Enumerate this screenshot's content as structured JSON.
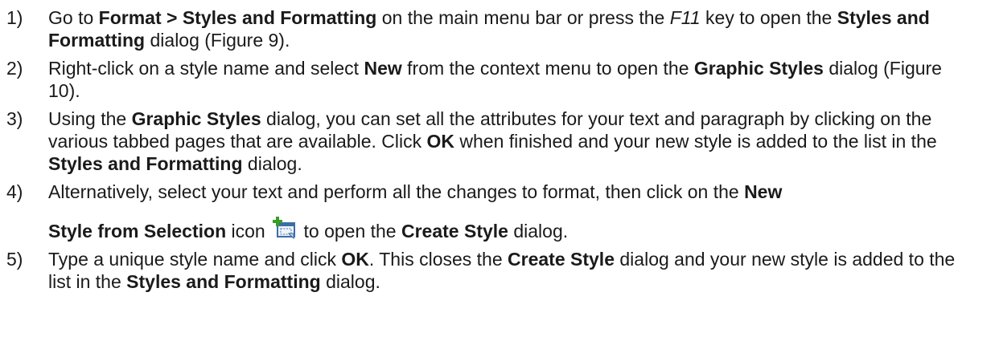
{
  "steps": [
    {
      "num": "1)",
      "segments": [
        {
          "t": "Go to ",
          "s": "n"
        },
        {
          "t": "Format > Styles and Formatting",
          "s": "b"
        },
        {
          "t": " on the main menu bar or press the ",
          "s": "n"
        },
        {
          "t": "F11",
          "s": "i"
        },
        {
          "t": " key to open the ",
          "s": "n"
        },
        {
          "t": "Styles and Formatting",
          "s": "b"
        },
        {
          "t": " dialog (Figure 9).",
          "s": "n"
        }
      ]
    },
    {
      "num": "2)",
      "segments": [
        {
          "t": "Right-click on a style name and select ",
          "s": "n"
        },
        {
          "t": "New",
          "s": "b"
        },
        {
          "t": " from the context menu to open the ",
          "s": "n"
        },
        {
          "t": "Graphic Styles",
          "s": "b"
        },
        {
          "t": " dialog (Figure 10).",
          "s": "n"
        }
      ]
    },
    {
      "num": "3)",
      "segments": [
        {
          "t": "Using the ",
          "s": "n"
        },
        {
          "t": "Graphic Styles",
          "s": "b"
        },
        {
          "t": " dialog, you can set all the attributes for your text and paragraph by clicking on the various tabbed pages that are available. Click ",
          "s": "n"
        },
        {
          "t": "OK",
          "s": "b"
        },
        {
          "t": " when finished and your new style is added to the list in the ",
          "s": "n"
        },
        {
          "t": "Styles and Formatting",
          "s": "b"
        },
        {
          "t": " dialog.",
          "s": "n"
        }
      ]
    },
    {
      "num": "4)",
      "line1": [
        {
          "t": "Alternatively, select your text and perform all the changes to format, then click on the ",
          "s": "n"
        },
        {
          "t": "New",
          "s": "b"
        }
      ],
      "line2_before_icon": [
        {
          "t": "Style from Selection",
          "s": "b"
        },
        {
          "t": " icon ",
          "s": "n"
        }
      ],
      "icon": "new-style-from-selection-icon",
      "line2_after_icon": [
        {
          "t": " to open the ",
          "s": "n"
        },
        {
          "t": "Create Style",
          "s": "b"
        },
        {
          "t": " dialog.",
          "s": "n"
        }
      ]
    },
    {
      "num": "5)",
      "segments": [
        {
          "t": "Type a unique style name and click ",
          "s": "n"
        },
        {
          "t": "OK",
          "s": "b"
        },
        {
          "t": ". This closes the ",
          "s": "n"
        },
        {
          "t": "Create Style",
          "s": "b"
        },
        {
          "t": " dialog and your new style is added to the list in the ",
          "s": "n"
        },
        {
          "t": "Styles and Formatting",
          "s": "b"
        },
        {
          "t": " dialog.",
          "s": "n"
        }
      ]
    }
  ],
  "colors": {
    "text": "#1a1a1a",
    "icon_plus": "#3a9d23",
    "icon_frame": "#3a6ea5"
  }
}
